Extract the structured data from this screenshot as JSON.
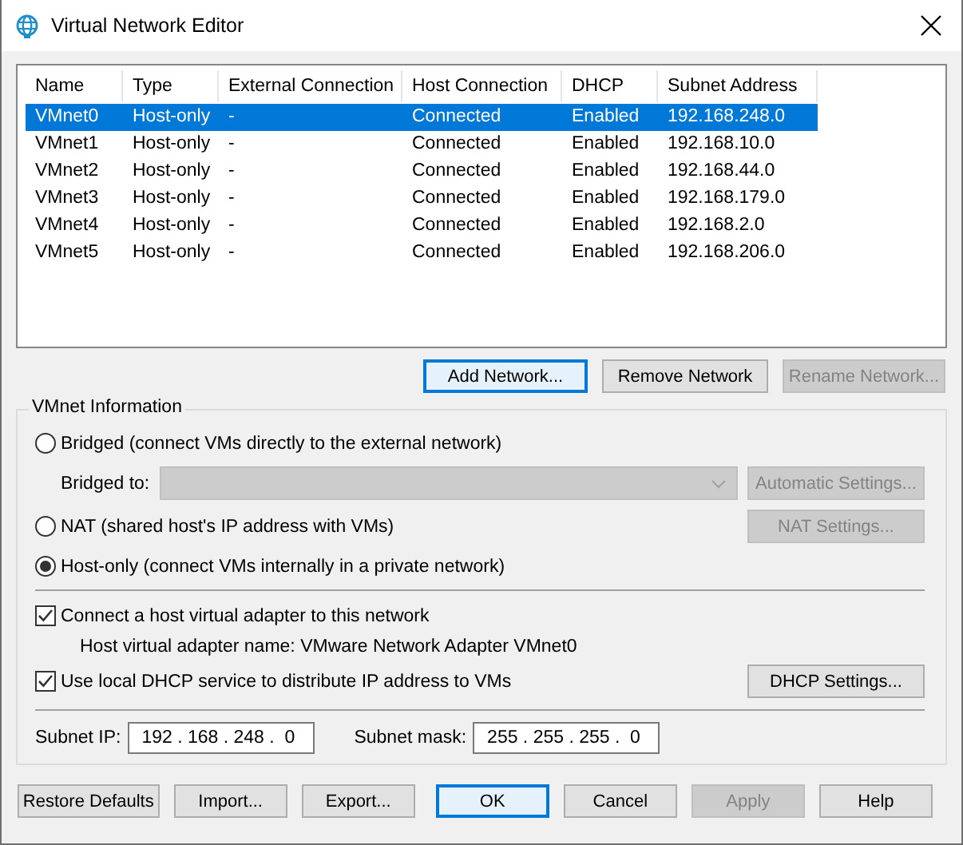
{
  "window": {
    "title": "Virtual Network Editor"
  },
  "table": {
    "columns": [
      "Name",
      "Type",
      "External Connection",
      "Host Connection",
      "DHCP",
      "Subnet Address"
    ],
    "rows": [
      {
        "cells": [
          "VMnet0",
          "Host-only",
          "-",
          "Connected",
          "Enabled",
          "192.168.248.0"
        ],
        "selected": true
      },
      {
        "cells": [
          "VMnet1",
          "Host-only",
          "-",
          "Connected",
          "Enabled",
          "192.168.10.0"
        ],
        "selected": false
      },
      {
        "cells": [
          "VMnet2",
          "Host-only",
          "-",
          "Connected",
          "Enabled",
          "192.168.44.0"
        ],
        "selected": false
      },
      {
        "cells": [
          "VMnet3",
          "Host-only",
          "-",
          "Connected",
          "Enabled",
          "192.168.179.0"
        ],
        "selected": false
      },
      {
        "cells": [
          "VMnet4",
          "Host-only",
          "-",
          "Connected",
          "Enabled",
          "192.168.2.0"
        ],
        "selected": false
      },
      {
        "cells": [
          "VMnet5",
          "Host-only",
          "-",
          "Connected",
          "Enabled",
          "192.168.206.0"
        ],
        "selected": false
      }
    ]
  },
  "network_buttons": [
    {
      "label": "Add Network...",
      "disabled": false,
      "focused": true
    },
    {
      "label": "Remove Network",
      "disabled": false,
      "focused": false
    },
    {
      "label": "Rename Network...",
      "disabled": true,
      "focused": false
    }
  ],
  "vmnet_information": {
    "title": "VMnet Information",
    "modes": [
      {
        "label": "Bridged (connect VMs directly to the external network)",
        "selected": false
      },
      {
        "label": "NAT (shared host's IP address with VMs)",
        "selected": false
      },
      {
        "label": "Host-only (connect VMs internally in a private network)",
        "selected": true
      }
    ],
    "bridged_to": {
      "label": "Bridged to:",
      "disabled": true
    },
    "automatic_settings": {
      "label": "Automatic Settings...",
      "disabled": true
    },
    "nat_settings": {
      "label": "NAT Settings...",
      "disabled": true
    },
    "connect_adapter": {
      "label": "Connect a host virtual adapter to this network",
      "checked": true
    },
    "adapter_name": "Host virtual adapter name: VMware Network Adapter VMnet0",
    "use_dhcp": {
      "label": "Use local DHCP service to distribute IP address to VMs",
      "checked": true
    },
    "dhcp_settings": {
      "label": "DHCP Settings...",
      "disabled": false
    },
    "subnet_ip": {
      "label": "Subnet IP:",
      "value": "192 . 168 . 248 .  0"
    },
    "subnet_mask": {
      "label": "Subnet mask:",
      "value": "255 . 255 . 255 .  0"
    }
  },
  "dialog_buttons": [
    {
      "label": "Restore Defaults",
      "disabled": false,
      "focused": false
    },
    {
      "label": "Import...",
      "disabled": false,
      "focused": false
    },
    {
      "label": "Export...",
      "disabled": false,
      "focused": false
    },
    {
      "label": "OK",
      "disabled": false,
      "focused": true
    },
    {
      "label": "Cancel",
      "disabled": false,
      "focused": false
    },
    {
      "label": "Apply",
      "disabled": true,
      "focused": false
    },
    {
      "label": "Help",
      "disabled": false,
      "focused": false
    }
  ]
}
